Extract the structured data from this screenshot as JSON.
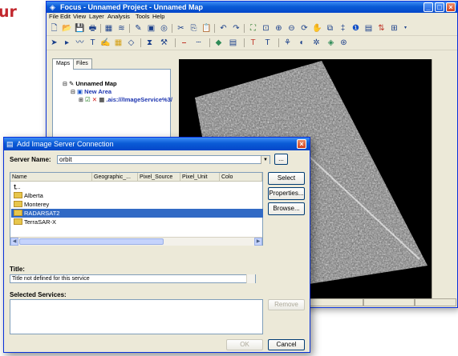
{
  "page": {
    "cropped_heading": "ur"
  },
  "main_window": {
    "title": "Focus - Unnamed Project - Unnamed Map",
    "menu": [
      "File",
      "Edit",
      "View",
      "Layer",
      "Analysis",
      "Tools",
      "Help"
    ],
    "left_tabs": [
      "Maps",
      "Files"
    ],
    "tree": {
      "root": "Unnamed Map",
      "area": "New Area",
      "layer": ".ais:///ImageService%3/"
    }
  },
  "dialog": {
    "title": "Add Image Server Connection",
    "server_label": "Server Name:",
    "server_value": "orbit",
    "browse_small": "...",
    "columns": [
      "Name",
      "Geographic_...",
      "Pixel_Source",
      "Pixel_Unit",
      "Colo"
    ],
    "rows": [
      {
        "name": "..",
        "icon": "up-folder-icon",
        "selected": false
      },
      {
        "name": "Alberta",
        "icon": "folder-icon",
        "selected": false
      },
      {
        "name": "Monterey",
        "icon": "folder-icon",
        "selected": false
      },
      {
        "name": "RADARSAT2",
        "icon": "folder-icon",
        "selected": true
      },
      {
        "name": "TerraSAR-X",
        "icon": "folder-icon",
        "selected": false
      }
    ],
    "buttons": {
      "select": "Select",
      "properties": "Properties...",
      "browse": "Browse...",
      "remove": "Remove",
      "ok": "OK",
      "cancel": "Cancel"
    },
    "title_label": "Title:",
    "title_value": "Title not defined for this service",
    "selected_services_label": "Selected Services:"
  },
  "colors": {
    "titlebar": "#0a5bd6",
    "selection": "#316ac5",
    "heading": "#c2272d"
  }
}
